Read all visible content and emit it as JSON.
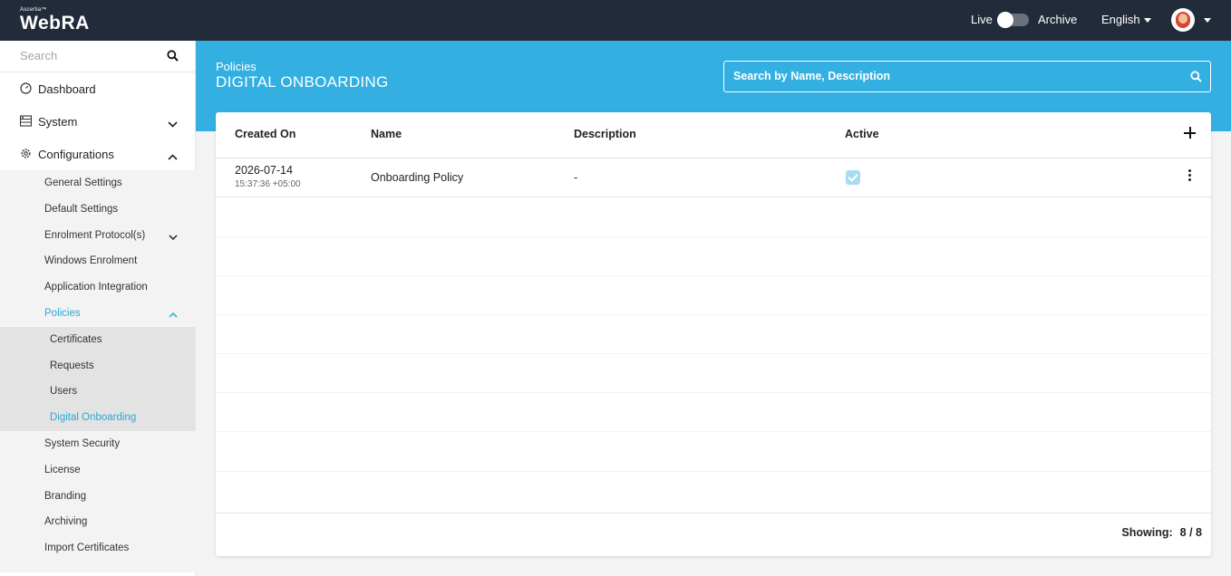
{
  "app": {
    "brand_small": "Ascertia™",
    "brand_name": "WebRA"
  },
  "topbar": {
    "live_label": "Live",
    "archive_label": "Archive",
    "language": "English",
    "live_toggle_on": false
  },
  "sidebar": {
    "search_placeholder": "Search",
    "items": [
      {
        "label": "Dashboard",
        "icon": "dashboard-icon"
      },
      {
        "label": "System",
        "icon": "server-icon"
      },
      {
        "label": "Configurations",
        "icon": "gear-icon"
      }
    ],
    "config_items": [
      {
        "label": "General Settings"
      },
      {
        "label": "Default Settings"
      },
      {
        "label": "Enrolment Protocol(s)"
      },
      {
        "label": "Windows Enrolment"
      },
      {
        "label": "Application Integration"
      },
      {
        "label": "Policies"
      },
      {
        "label": "System Security"
      },
      {
        "label": "License"
      },
      {
        "label": "Branding"
      },
      {
        "label": "Archiving"
      },
      {
        "label": "Import Certificates"
      }
    ],
    "policy_items": [
      {
        "label": "Certificates"
      },
      {
        "label": "Requests"
      },
      {
        "label": "Users"
      },
      {
        "label": "Digital Onboarding"
      }
    ]
  },
  "header": {
    "breadcrumb": "Policies",
    "title": "DIGITAL ONBOARDING",
    "search_placeholder": "Search by Name, Description"
  },
  "table": {
    "columns": [
      "Created On",
      "Name",
      "Description",
      "Active"
    ],
    "rows": [
      {
        "date": "2026-07-14",
        "time": "15:37:36 +05:00",
        "name": "Onboarding Policy",
        "description": "-",
        "active": true
      }
    ],
    "footer_label": "Showing:",
    "footer_value": "8 / 8"
  },
  "colors": {
    "topbar": "#222b3a",
    "accent": "#33b0e1",
    "active_link": "#2aa8d8"
  }
}
